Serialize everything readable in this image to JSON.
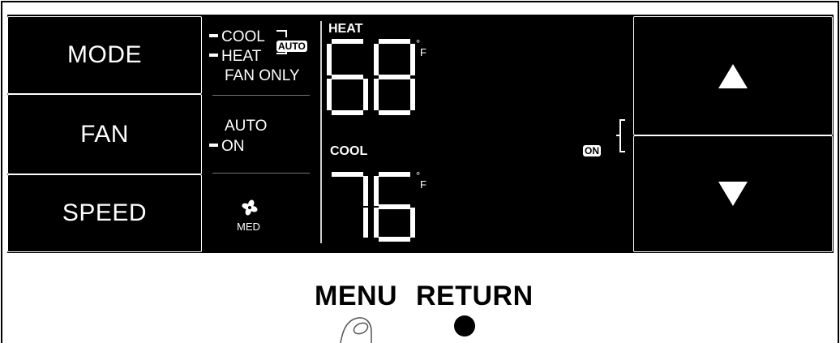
{
  "left_buttons": {
    "mode": "MODE",
    "fan": "FAN",
    "speed": "SPEED"
  },
  "mode_indicators": {
    "cool": "COOL",
    "heat": "HEAT",
    "fan_only": "FAN ONLY",
    "auto_badge": "AUTO"
  },
  "fan_indicators": {
    "auto": "AUTO",
    "on": "ON"
  },
  "fan_speed": {
    "label": "MED",
    "icon": "fan-icon"
  },
  "heat_setpoint": {
    "label": "HEAT",
    "value": "68",
    "unit_degree": "°",
    "unit": "F"
  },
  "cool_setpoint": {
    "label": "COOL",
    "value": "76",
    "unit_degree": "°",
    "unit": "F"
  },
  "on_badge": "ON",
  "right_buttons": {
    "up_icon": "triangle-up-icon",
    "down_icon": "triangle-down-icon"
  },
  "bottom": {
    "menu_label": "MENU",
    "return_label": "RETURN"
  },
  "colors": {
    "panel": "#000000",
    "text_on_panel": "#ffffff",
    "background": "#ffffff"
  }
}
